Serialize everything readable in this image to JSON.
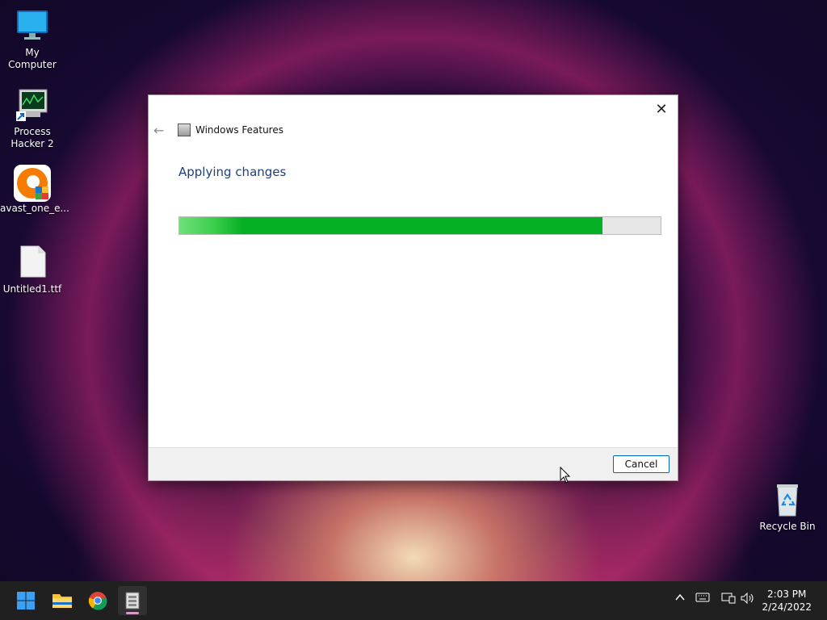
{
  "desktop": {
    "icons": [
      {
        "label": "My Computer",
        "icon": "monitor-icon"
      },
      {
        "label": "Process\nHacker 2",
        "icon": "process-hacker-icon"
      },
      {
        "label": "avast_one_e...",
        "icon": "avast-icon"
      },
      {
        "label": "Untitled1.ttf",
        "icon": "file-icon"
      },
      {
        "label": "Recycle Bin",
        "icon": "recycle-bin-icon"
      }
    ]
  },
  "dialog": {
    "app_title": "Windows Features",
    "heading": "Applying changes",
    "progress_fraction": 0.88,
    "progress_color": "#06b025",
    "cancel_label": "Cancel"
  },
  "taskbar": {
    "apps": [
      "start-icon",
      "file-explorer-icon",
      "chrome-icon",
      "windows-features-icon"
    ],
    "clock": {
      "time": "2:03 PM",
      "date": "2/24/2022"
    }
  }
}
